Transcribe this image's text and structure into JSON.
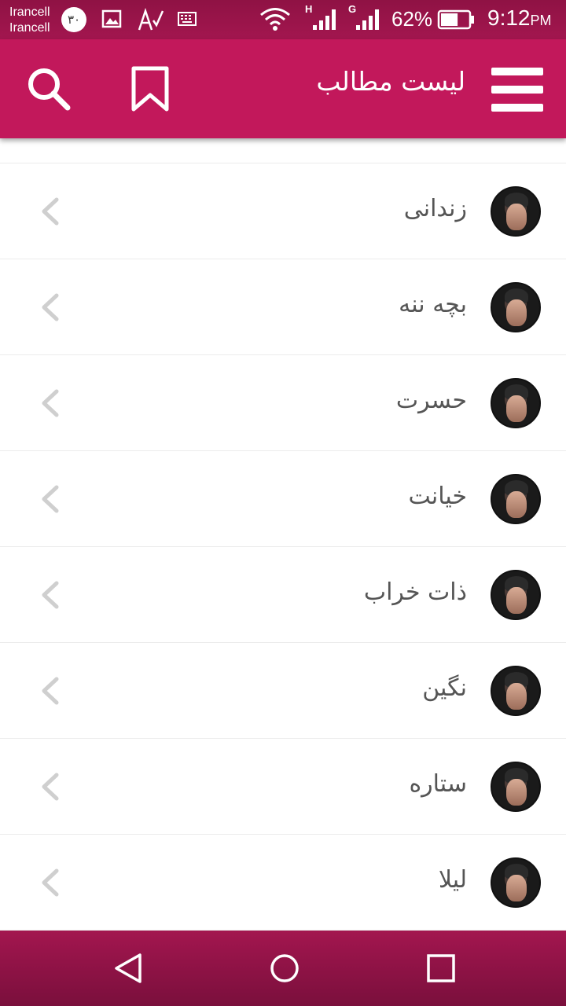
{
  "status_bar": {
    "carrier_1": "Irancell",
    "carrier_2": "Irancell",
    "notification_badge": "۳۰",
    "network_1": "H",
    "network_2": "G",
    "battery_percent": "62%",
    "battery_level": 0.62,
    "time": "9:12",
    "time_suffix": "PM"
  },
  "app_bar": {
    "title": "لیست مطالب",
    "color": "#c2185b"
  },
  "list": {
    "items": [
      {
        "label": "زندانی"
      },
      {
        "label": "بچه ننه"
      },
      {
        "label": "حسرت"
      },
      {
        "label": "خیانت"
      },
      {
        "label": "ذات خراب"
      },
      {
        "label": "نگین"
      },
      {
        "label": "ستاره"
      },
      {
        "label": "لیلا"
      }
    ]
  },
  "icons": {
    "menu": "menu-icon",
    "bookmark": "bookmark-icon",
    "search": "search-icon",
    "chevron": "chevron-left-icon",
    "back": "back-icon",
    "home": "home-icon",
    "recents": "recents-icon"
  }
}
